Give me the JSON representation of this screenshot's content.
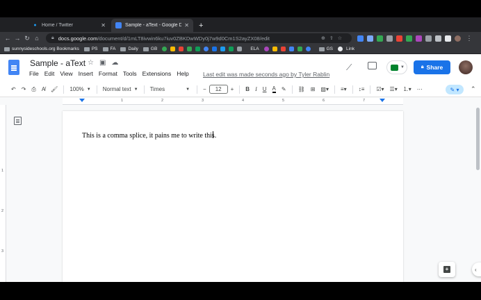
{
  "browser": {
    "tabs": [
      {
        "title": "Home / Twitter",
        "close": "✕"
      },
      {
        "title": "Sample - aText - Google Docs",
        "close": "✕"
      }
    ],
    "new_tab": "+",
    "url_domain": "docs.google.com",
    "url_path": "/document/d/1mLT8ivwin6ku7iuv0ZBKDwWDy0j7w9d0Cm1S2ayZX08/edit",
    "bookmarks": [
      "sunnysideschools.org Bookmarks",
      "PS",
      "FA",
      "Daily",
      "GB",
      "ELA",
      "GS",
      "Link"
    ]
  },
  "docs": {
    "title": "Sample - aText",
    "menu": [
      "File",
      "Edit",
      "View",
      "Insert",
      "Format",
      "Tools",
      "Extensions",
      "Help"
    ],
    "last_edit": "Last edit was made seconds ago by Tyler Rablin",
    "share_label": "Share",
    "toolbar": {
      "zoom": "100%",
      "style": "Normal text",
      "font": "Times",
      "font_size": "12",
      "minus": "−",
      "plus": "+"
    },
    "ruler_numbers": [
      "1",
      "2",
      "3",
      "4",
      "5",
      "6"
    ],
    "vruler_numbers": [
      "1",
      "2",
      "3"
    ],
    "body_text": "This is a comma splice, it pains me to write this."
  },
  "colors": {
    "accent": "#1a73e8",
    "docs_blue": "#4285f4"
  }
}
